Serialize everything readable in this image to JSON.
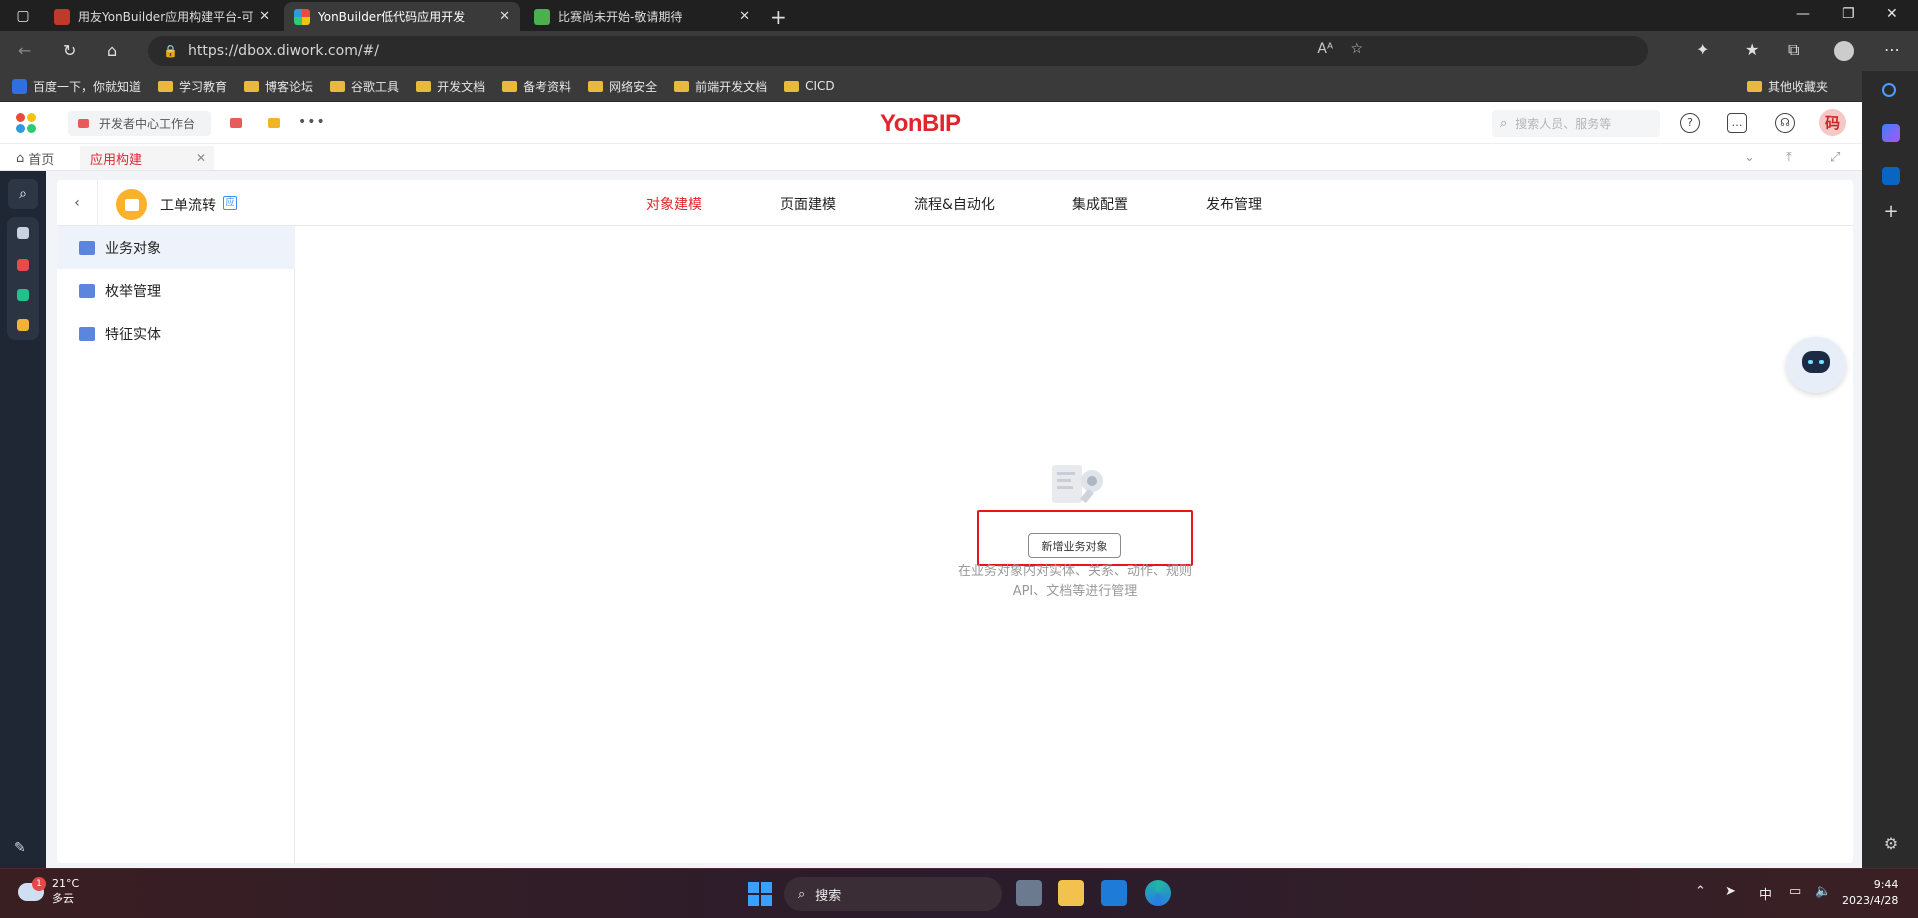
{
  "browser": {
    "tabs": [
      {
        "title": "用友YonBuilder应用构建平台-可...",
        "color": "#c0392b"
      },
      {
        "title": "YonBuilder低代码应用开发",
        "color": "#f0a030"
      },
      {
        "title": "比赛尚未开始-敬请期待",
        "color": "#4caf50"
      }
    ],
    "address": "https://dbox.diwork.com/#/",
    "bookmarks": [
      "百度一下，你就知道",
      "学习教育",
      "博客论坛",
      "谷歌工具",
      "开发文档",
      "备考资料",
      "网络安全",
      "前端开发文档",
      "CICD"
    ],
    "bookmarks_other": "其他收藏夹"
  },
  "app_header": {
    "workspace": "开发者中心工作台",
    "brand": "YonBIP",
    "search_placeholder": "搜索人员、服务等",
    "avatar_text": "码"
  },
  "app_tabs": {
    "home": "首页",
    "active": "应用构建"
  },
  "panel": {
    "app_name": "工单流转",
    "app_badge": "应",
    "main_tabs": [
      "对象建模",
      "页面建模",
      "流程&自动化",
      "集成配置",
      "发布管理"
    ],
    "menu": [
      "业务对象",
      "枚举管理",
      "特征实体"
    ],
    "empty": {
      "button": "新增业务对象",
      "desc_line1": "在业务对象内对实体、关系、动作、规则",
      "desc_line2": "API、文档等进行管理"
    }
  },
  "taskbar": {
    "temp": "21°C",
    "weather": "多云",
    "weather_badge": "1",
    "search": "搜索",
    "ime": "中",
    "time": "9:44",
    "date": "2023/4/28"
  }
}
